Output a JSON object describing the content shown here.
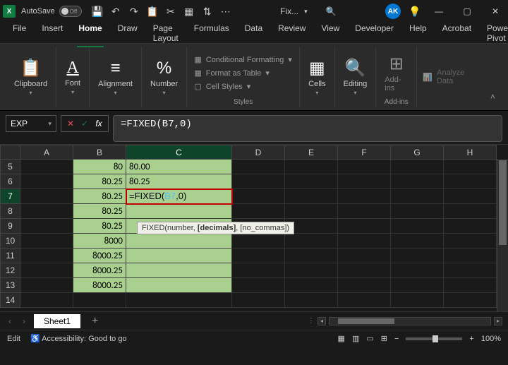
{
  "title_bar": {
    "autosave_label": "AutoSave",
    "autosave_state": "Off",
    "doc_name": "Fix...",
    "avatar": "AK"
  },
  "tabs": [
    "File",
    "Insert",
    "Home",
    "Draw",
    "Page Layout",
    "Formulas",
    "Data",
    "Review",
    "View",
    "Developer",
    "Help",
    "Acrobat",
    "Power Pivot"
  ],
  "active_tab": "Home",
  "ribbon": {
    "clipboard": "Clipboard",
    "font": "Font",
    "alignment": "Alignment",
    "number": "Number",
    "cond_fmt": "Conditional Formatting",
    "fmt_table": "Format as Table",
    "cell_styles": "Cell Styles",
    "styles": "Styles",
    "cells": "Cells",
    "editing": "Editing",
    "addins": "Add-ins",
    "analyze": "Analyze Data"
  },
  "name_box": "EXP",
  "formula": "=FIXED(B7,0)",
  "cell_formula": {
    "pre": "=FIXED(",
    "ref": "B7",
    "post": ",0)"
  },
  "tooltip": {
    "fn": "FIXED(number, ",
    "bold": "[decimals]",
    "rest": ", [no_commas])"
  },
  "columns": [
    "A",
    "B",
    "C",
    "D",
    "E",
    "F",
    "G",
    "H"
  ],
  "rows": [
    5,
    6,
    7,
    8,
    9,
    10,
    11,
    12,
    13,
    14
  ],
  "chart_data": {
    "type": "table",
    "active_cell": "C7",
    "data": [
      {
        "row": 5,
        "B": "80",
        "C": "80.00"
      },
      {
        "row": 6,
        "B": "80.25",
        "C": "80.25"
      },
      {
        "row": 7,
        "B": "80.25",
        "C": "=FIXED(B7,0)"
      },
      {
        "row": 8,
        "B": "80.25",
        "C": ""
      },
      {
        "row": 9,
        "B": "80.25",
        "C": ""
      },
      {
        "row": 10,
        "B": "8000",
        "C": ""
      },
      {
        "row": 11,
        "B": "8000.25",
        "C": ""
      },
      {
        "row": 12,
        "B": "8000.25",
        "C": ""
      },
      {
        "row": 13,
        "B": "8000.25",
        "C": ""
      },
      {
        "row": 14,
        "B": "",
        "C": ""
      }
    ]
  },
  "sheet_tab": "Sheet1",
  "status": {
    "mode": "Edit",
    "accessibility": "Accessibility: Good to go",
    "zoom": "100%"
  }
}
